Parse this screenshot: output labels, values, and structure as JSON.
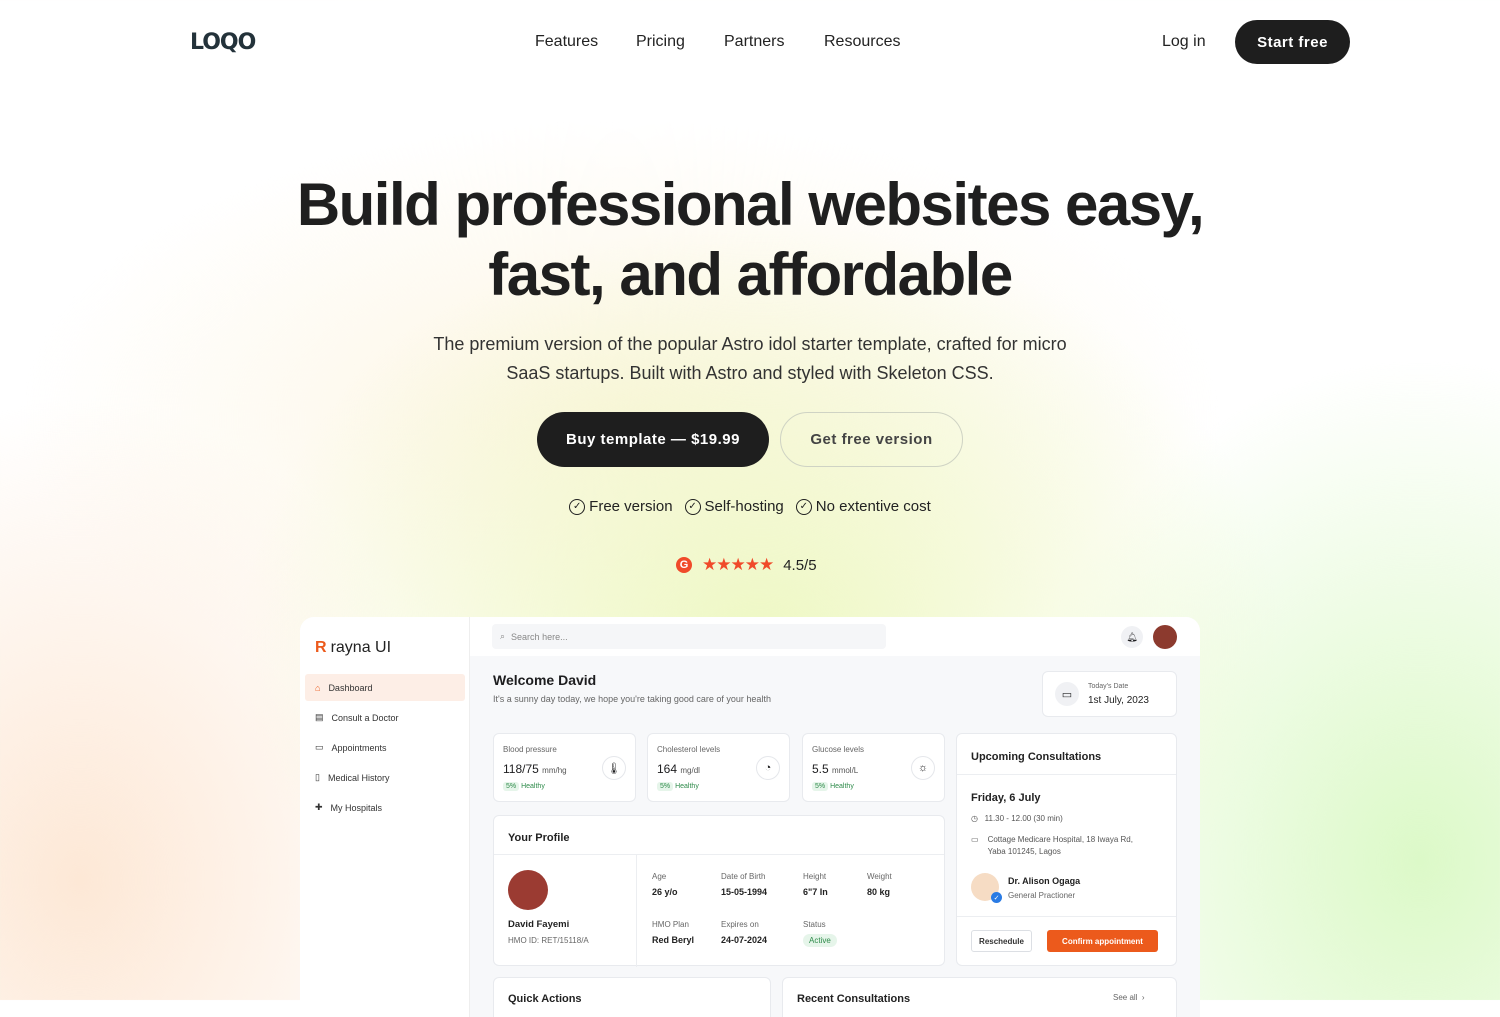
{
  "nav": {
    "logo": "LOQO",
    "links": [
      "Features",
      "Pricing",
      "Partners",
      "Resources"
    ],
    "login": "Log in",
    "start": "Start free"
  },
  "hero": {
    "title_line1": "Build professional websites easy,",
    "title_line2": "fast, and affordable",
    "subtitle_line1": "The premium version of the popular Astro idol starter template, crafted for micro",
    "subtitle_line2": "SaaS startups. Built with Astro and styled with Skeleton CSS.",
    "buy": "Buy template — $19.99",
    "free": "Get free version",
    "checks": [
      "Free version",
      "Self-hosting",
      "No extentive cost"
    ],
    "rating": {
      "stars": "★★★★★",
      "value": "4.5/5",
      "score": 4.5,
      "max": 5,
      "color": "#f04a2a"
    }
  },
  "dashboard": {
    "brand": "rayna UI",
    "sidebar": [
      {
        "label": "Dashboard",
        "icon": "home-icon"
      },
      {
        "label": "Consult a Doctor",
        "icon": "chat-icon"
      },
      {
        "label": "Appointments",
        "icon": "calendar-icon"
      },
      {
        "label": "Medical History",
        "icon": "document-icon"
      },
      {
        "label": "My Hospitals",
        "icon": "cross-icon"
      }
    ],
    "search_placeholder": "Search here...",
    "welcome": "Welcome David",
    "welcome_sub": "It's a sunny day today, we hope you're taking good care of your health",
    "date_label": "Today's Date",
    "date": "1st July, 2023",
    "metrics": [
      {
        "label": "Blood pressure",
        "value": "118/75",
        "unit": "mm/hg",
        "change": "5%",
        "status": "Healthy",
        "icon": "thermometer-icon",
        "glyph": "🌡"
      },
      {
        "label": "Cholesterol levels",
        "value": "164",
        "unit": "mg/dl",
        "change": "5%",
        "status": "Healthy",
        "icon": "gauge-icon",
        "glyph": "◔"
      },
      {
        "label": "Glucose levels",
        "value": "5.5",
        "unit": "mmol/L",
        "change": "5%",
        "status": "Healthy",
        "icon": "sun-icon",
        "glyph": "☼"
      }
    ],
    "profile": {
      "title": "Your Profile",
      "name": "David Fayemi",
      "hmo_id": "HMO ID: RET/15118/A",
      "fields": [
        {
          "label": "Age",
          "value": "26 y/o"
        },
        {
          "label": "Date of Birth",
          "value": "15-05-1994"
        },
        {
          "label": "Height",
          "value": "6\"7 In"
        },
        {
          "label": "Weight",
          "value": "80 kg"
        },
        {
          "label": "HMO Plan",
          "value": "Red Beryl"
        },
        {
          "label": "Expires on",
          "value": "24-07-2024"
        }
      ],
      "status_label": "Status",
      "status": "Active"
    },
    "upcoming": {
      "title": "Upcoming Consultations",
      "day": "Friday, 6 July",
      "time": "11.30 - 12.00 (30 min)",
      "address_line1": "Cottage Medicare Hospital, 18 Iwaya Rd,",
      "address_line2": "Yaba 101245, Lagos",
      "doctor": "Dr. Alison Ogaga",
      "role": "General Practioner",
      "reschedule": "Reschedule",
      "confirm": "Confirm appointment"
    },
    "quick_actions": "Quick Actions",
    "recent": "Recent Consultations",
    "see_all": "See all"
  },
  "colors": {
    "accent": "#ec5a1c",
    "dark": "#1e1e1e"
  }
}
